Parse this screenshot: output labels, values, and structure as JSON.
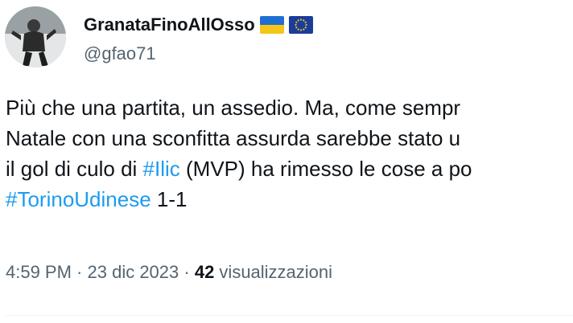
{
  "tweet": {
    "author": {
      "display_name": "GranataFinoAllOsso",
      "handle": "@gfao71",
      "flags": [
        "ukraine-flag-icon",
        "eu-flag-icon"
      ]
    },
    "text": {
      "line1": "Più che una partita, un assedio. Ma, come sempr",
      "line2": "Natale con una sconfitta assurda sarebbe stato u",
      "line3_pre": "il gol di culo di ",
      "line3_hashtag": "#Ilic",
      "line3_post": " (MVP) ha rimesso le cose a po",
      "line4_hashtag": "#TorinoUdinese",
      "line4_post": " 1-1"
    },
    "meta": {
      "time": "4:59 PM",
      "separator1": " · ",
      "date": "23 dic 2023",
      "separator2": " · ",
      "views_count": "42",
      "views_label": " visualizzazioni"
    },
    "colors": {
      "text": "#0f1419",
      "secondary": "#536471",
      "hashtag": "#1d9bf0"
    }
  }
}
